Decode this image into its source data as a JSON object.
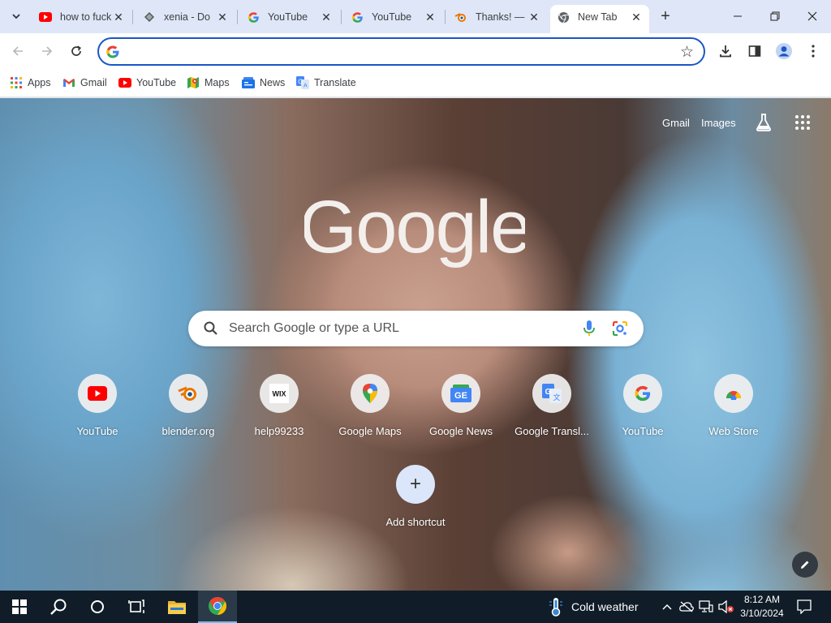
{
  "tabs": [
    {
      "title": "how to fuck",
      "favicon": "youtube-icon"
    },
    {
      "title": "xenia - Do",
      "favicon": "diamond-icon"
    },
    {
      "title": "YouTube",
      "favicon": "google-g-icon"
    },
    {
      "title": "YouTube",
      "favicon": "google-g-icon"
    },
    {
      "title": "Thanks! —",
      "favicon": "blender-icon"
    },
    {
      "title": "New Tab",
      "favicon": "chrome-icon",
      "active": true
    }
  ],
  "omnibox": {
    "value": "",
    "placeholder": ""
  },
  "bookmarks": [
    {
      "label": "Apps",
      "icon": "apps-grid-icon"
    },
    {
      "label": "Gmail",
      "icon": "gmail-icon"
    },
    {
      "label": "YouTube",
      "icon": "youtube-icon"
    },
    {
      "label": "Maps",
      "icon": "maps-icon"
    },
    {
      "label": "News",
      "icon": "news-icon"
    },
    {
      "label": "Translate",
      "icon": "translate-icon"
    }
  ],
  "ntp": {
    "links": {
      "gmail": "Gmail",
      "images": "Images"
    },
    "logo_text": "Google",
    "search_placeholder": "Search Google or type a URL",
    "shortcuts": [
      {
        "label": "YouTube",
        "icon": "youtube-icon"
      },
      {
        "label": "blender.org",
        "icon": "blender-icon"
      },
      {
        "label": "help99233",
        "icon": "wix-icon"
      },
      {
        "label": "Google Maps",
        "icon": "maps-pin-icon"
      },
      {
        "label": "Google News",
        "icon": "google-news-icon"
      },
      {
        "label": "Google Transl...",
        "icon": "google-translate-icon"
      },
      {
        "label": "YouTube",
        "icon": "google-g-icon"
      },
      {
        "label": "Web Store",
        "icon": "web-store-icon"
      }
    ],
    "add_shortcut": "Add shortcut"
  },
  "taskbar": {
    "weather": "Cold weather",
    "time": "8:12 AM",
    "date": "3/10/2024"
  },
  "colors": {
    "omnibox_border": "#1a56c6",
    "tabstrip_bg": "#dfe6f7",
    "taskbar_bg": "#101d28"
  }
}
